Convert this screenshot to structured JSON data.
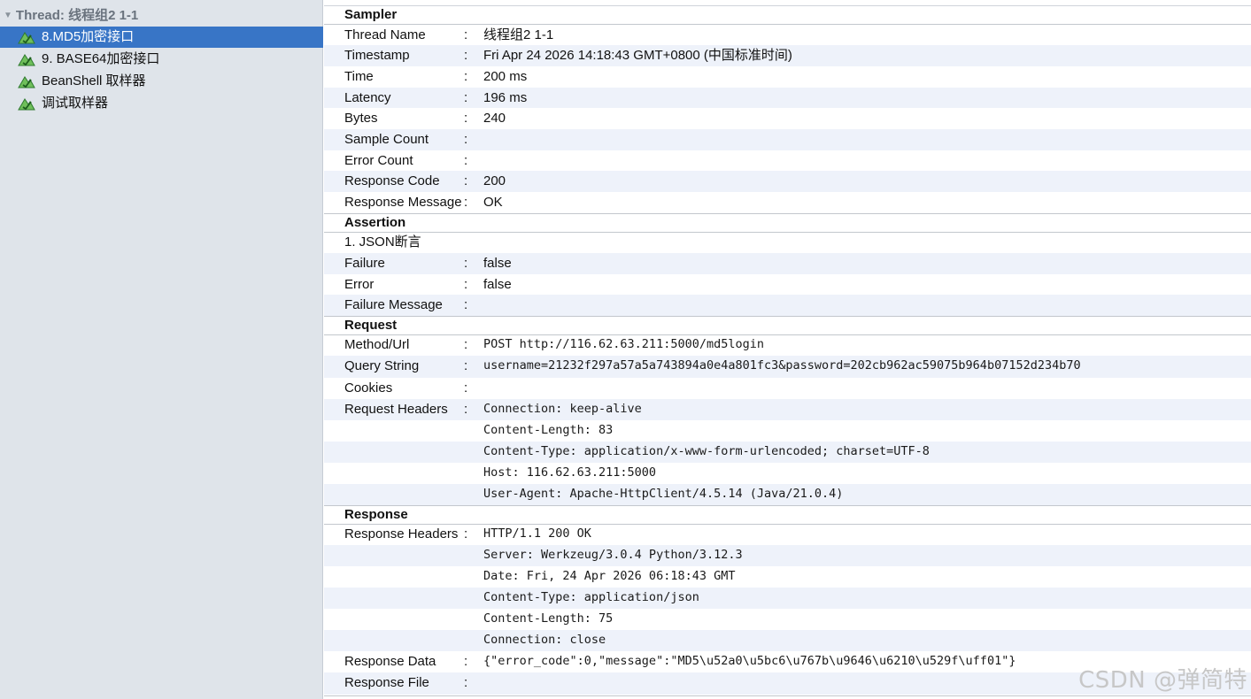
{
  "tree": {
    "root_label": "Thread: 线程组2 1-1",
    "items": [
      {
        "label": "8.MD5加密接口",
        "selected": true
      },
      {
        "label": "9. BASE64加密接口",
        "selected": false
      },
      {
        "label": "BeanShell 取样器",
        "selected": false
      },
      {
        "label": "调试取样器",
        "selected": false
      }
    ]
  },
  "detail": {
    "separator": ":",
    "sampler": {
      "title": "Sampler",
      "rows": [
        {
          "key": "Thread Name",
          "value": "线程组2 1-1"
        },
        {
          "key": "Timestamp",
          "value": "Fri Apr 24 2026 14:18:43 GMT+0800 (中国标准时间)"
        },
        {
          "key": "Time",
          "value": "200 ms"
        },
        {
          "key": "Latency",
          "value": "196 ms"
        },
        {
          "key": "Bytes",
          "value": "240"
        },
        {
          "key": "Sample Count",
          "value": ""
        },
        {
          "key": "Error Count",
          "value": ""
        },
        {
          "key": "Response Code",
          "value": "200"
        },
        {
          "key": "Response Message",
          "value": "OK"
        }
      ]
    },
    "assertion": {
      "title": "Assertion",
      "name": "1. JSON断言",
      "rows": [
        {
          "key": "Failure",
          "value": "false"
        },
        {
          "key": "Error",
          "value": "false"
        },
        {
          "key": "Failure Message",
          "value": ""
        }
      ]
    },
    "request": {
      "title": "Request",
      "method_url": {
        "key": "Method/Url",
        "value": "POST http://116.62.63.211:5000/md5login"
      },
      "query_string": {
        "key": "Query String",
        "value": "username=21232f297a57a5a743894a0e4a801fc3&password=202cb962ac59075b964b07152d234b70"
      },
      "cookies": {
        "key": "Cookies",
        "value": ""
      },
      "headers_key": "Request Headers",
      "headers": [
        "Connection: keep-alive",
        "Content-Length: 83",
        "Content-Type: application/x-www-form-urlencoded; charset=UTF-8",
        "Host: 116.62.63.211:5000",
        "User-Agent: Apache-HttpClient/4.5.14 (Java/21.0.4)"
      ]
    },
    "response": {
      "title": "Response",
      "headers_key": "Response Headers",
      "headers": [
        "HTTP/1.1 200 OK",
        "Server: Werkzeug/3.0.4 Python/3.12.3",
        "Date: Fri, 24 Apr 2026 06:18:43 GMT",
        "Content-Type: application/json",
        "Content-Length: 75",
        "Connection: close"
      ],
      "data": {
        "key": "Response Data",
        "value": "{\"error_code\":0,\"message\":\"MD5\\u52a0\\u5bc6\\u767b\\u9646\\u6210\\u529f\\uff01\"}"
      },
      "file": {
        "key": "Response File",
        "value": ""
      }
    }
  },
  "watermark": "CSDN @弹简特",
  "colors": {
    "selection": "#3875c6",
    "tree_bg": "#dfe4ea",
    "row_alt": "#eef2fa",
    "icon_green": "#3a9a3a"
  }
}
